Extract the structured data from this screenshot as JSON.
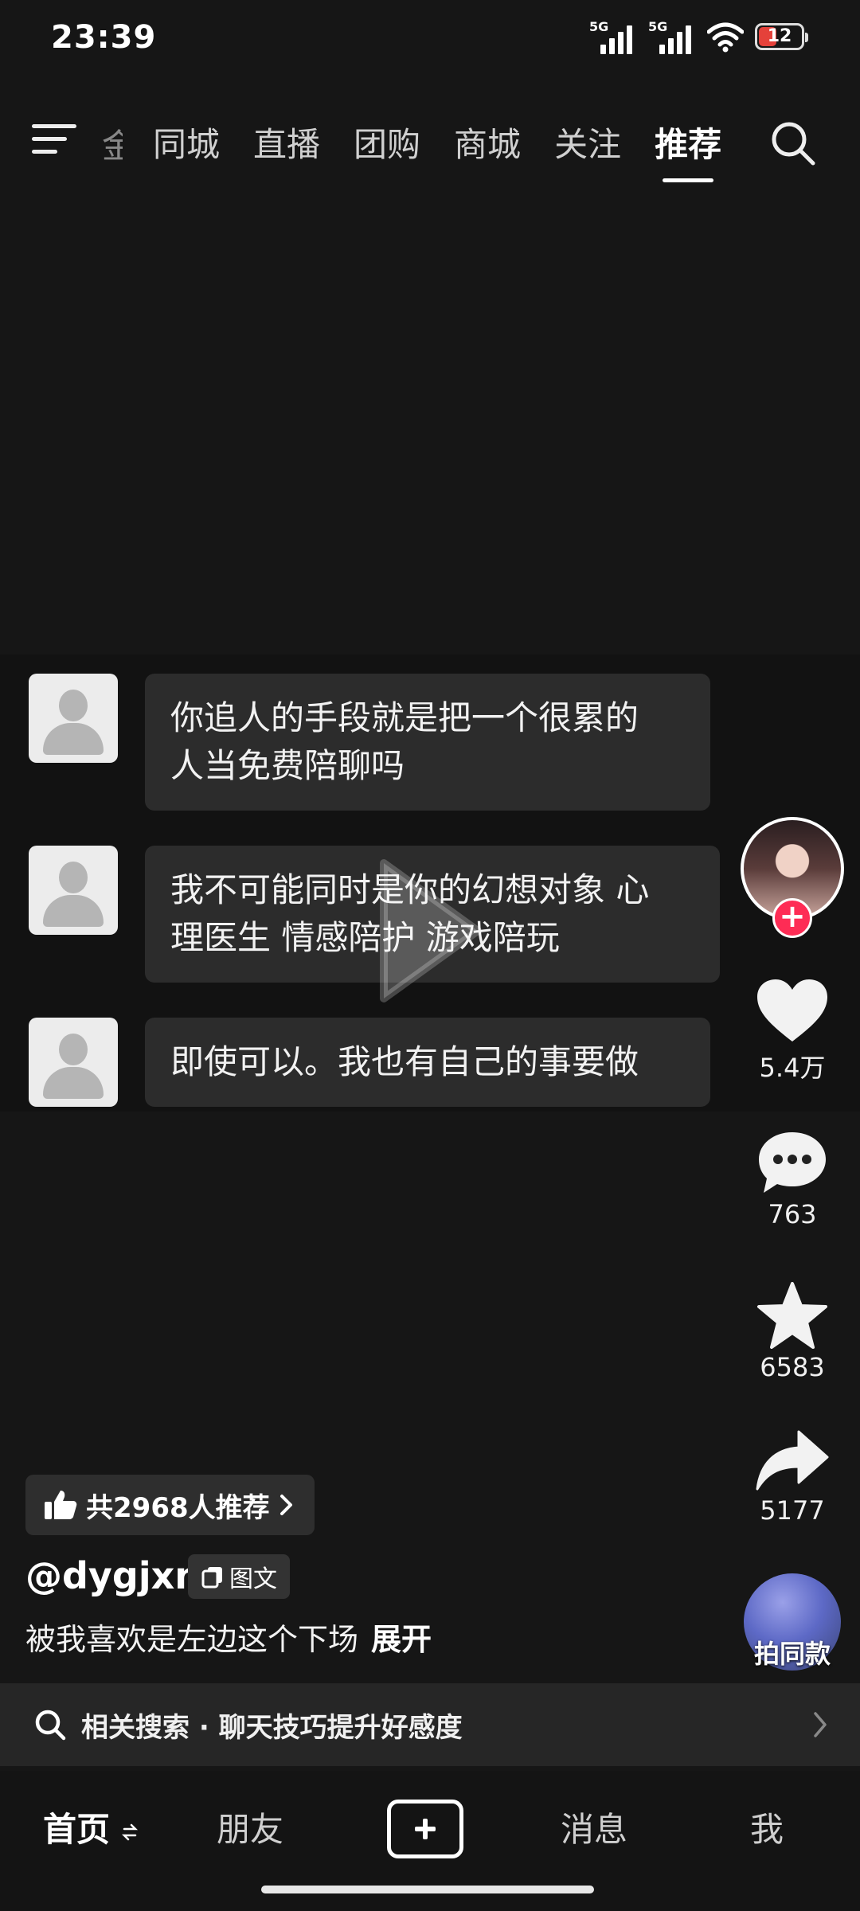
{
  "status_bar": {
    "time": "23:39",
    "signal1": "5G",
    "signal2": "5G",
    "battery": "12"
  },
  "top_nav": {
    "partial_tab": "金",
    "tabs": [
      {
        "label": "同城"
      },
      {
        "label": "直播"
      },
      {
        "label": "团购"
      },
      {
        "label": "商城"
      },
      {
        "label": "关注"
      },
      {
        "label": "推荐",
        "active": true
      }
    ]
  },
  "chat": {
    "messages": [
      {
        "line1": "你追人的手段就是把一个很累的",
        "line2": "人当免费陪聊吗"
      },
      {
        "line1": "我不可能同时是你的幻想对象 心",
        "line2": "理医生 情感陪护 游戏陪玩"
      },
      {
        "line1": "即使可以。我也有自己的事要做"
      }
    ]
  },
  "actions": {
    "like_count": "5.4万",
    "comment_count": "763",
    "favorite_count": "6583",
    "share_count": "5177",
    "remix_label": "拍同款"
  },
  "post": {
    "recommend_text": "共2968人推荐",
    "author": "@dygjxn",
    "type_tag": "图文",
    "caption": "被我喜欢是左边这个下场",
    "expand": "展开"
  },
  "related_search": {
    "prefix": "相关搜索",
    "dot": "·",
    "query": "聊天技巧提升好感度"
  },
  "bottom_nav": {
    "home": "首页",
    "friends": "朋友",
    "messages": "消息",
    "me": "我"
  },
  "colors": {
    "background": "#161616",
    "accent": "#fe2c55"
  }
}
